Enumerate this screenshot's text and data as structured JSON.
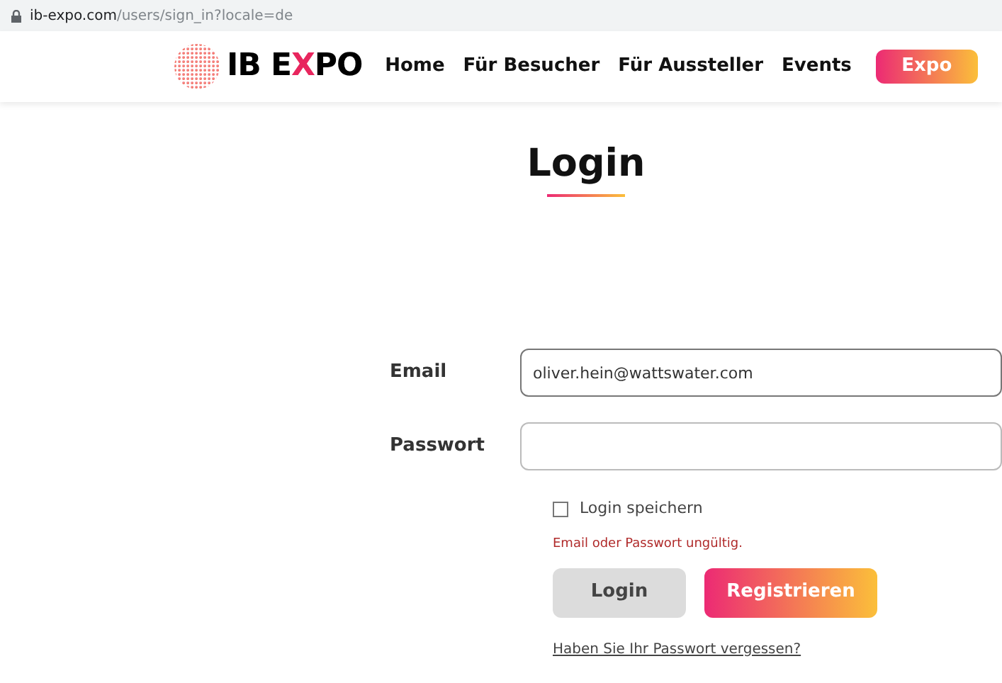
{
  "address_bar": {
    "url_host": "ib-expo.com",
    "url_path": "/users/sign_in?locale=de"
  },
  "header": {
    "logo": [
      {
        "text": "IB E",
        "accent": false
      },
      {
        "text": "X",
        "accent": true
      },
      {
        "text": "PO",
        "accent": false
      }
    ],
    "nav": [
      {
        "label": "Home",
        "kind": "link"
      },
      {
        "label": "Für Besucher",
        "kind": "link"
      },
      {
        "label": "Für Aussteller",
        "kind": "link"
      },
      {
        "label": "Events",
        "kind": "link"
      },
      {
        "label": "Expo",
        "kind": "button"
      }
    ]
  },
  "title": "Login",
  "form": {
    "fields": [
      {
        "label": "Email",
        "value": "oliver.hein@wattswater.com"
      },
      {
        "label": "Passwort"
      }
    ],
    "remember": {
      "label": "Login speichern",
      "checked": false
    },
    "error": "Email oder Passwort ungültig.",
    "buttons": [
      {
        "label": "Login",
        "kind": "secondary"
      },
      {
        "label": "Registrieren",
        "kind": "primary"
      }
    ],
    "forgot_link": "Haben Sie Ihr Passwort vergessen?"
  }
}
